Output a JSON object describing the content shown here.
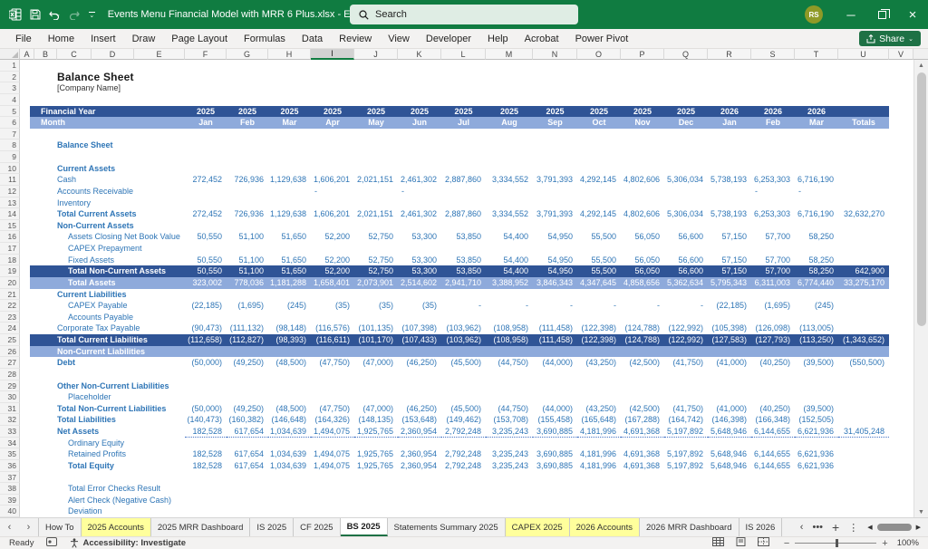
{
  "window": {
    "title": "Events Menu Financial Model with MRR 6 Plus.xlsx  -  Excel",
    "search_label": "Search",
    "avatar_initials": "RS"
  },
  "ribbon": {
    "tabs": [
      "File",
      "Home",
      "Insert",
      "Draw",
      "Page Layout",
      "Formulas",
      "Data",
      "Review",
      "View",
      "Developer",
      "Help",
      "Acrobat",
      "Power Pivot"
    ],
    "share_label": "Share"
  },
  "grid": {
    "columns": [
      "A",
      "B",
      "C",
      "D",
      "E",
      "F",
      "G",
      "H",
      "I",
      "J",
      "K",
      "L",
      "M",
      "N",
      "O",
      "P",
      "Q",
      "R",
      "S",
      "T",
      "U",
      "V"
    ],
    "selected_column": "I"
  },
  "sheet": {
    "header": {
      "financial_year_label": "Financial Year",
      "month_label": "Month",
      "totals_label": "Totals",
      "years": [
        "2025",
        "2025",
        "2025",
        "2025",
        "2025",
        "2025",
        "2025",
        "2025",
        "2025",
        "2025",
        "2025",
        "2025",
        "2026",
        "2026",
        "2026"
      ],
      "months": [
        "Jan",
        "Feb",
        "Mar",
        "Apr",
        "May",
        "Jun",
        "Jul",
        "Aug",
        "Sep",
        "Oct",
        "Nov",
        "Dec",
        "Jan",
        "Feb",
        "Mar"
      ]
    },
    "rows": [
      {
        "n": 1
      },
      {
        "n": 2,
        "label": "Balance Sheet",
        "style": "title"
      },
      {
        "n": 3,
        "label": "[Company Name]",
        "style": "subtitle"
      },
      {
        "n": 4
      },
      {
        "n": 5,
        "style": "year-header"
      },
      {
        "n": 6,
        "style": "month-header"
      },
      {
        "n": 7
      },
      {
        "n": 8,
        "label": "Balance Sheet",
        "style": "bold"
      },
      {
        "n": 9
      },
      {
        "n": 10,
        "label": "Current Assets",
        "style": "bold"
      },
      {
        "n": 11,
        "label": "Cash",
        "style": "plain",
        "values": [
          "272,452",
          "726,936",
          "1,129,638",
          "1,606,201",
          "2,021,151",
          "2,461,302",
          "2,887,860",
          "3,334,552",
          "3,791,393",
          "4,292,145",
          "4,802,606",
          "5,306,034",
          "5,738,193",
          "6,253,303",
          "6,716,190"
        ]
      },
      {
        "n": 12,
        "label": "Accounts Receivable",
        "style": "plain",
        "dash_left": true,
        "values": [
          "",
          "",
          "",
          "-",
          "",
          "-",
          "",
          "",
          "",
          "",
          "",
          "",
          "",
          "-",
          "-"
        ]
      },
      {
        "n": 13,
        "label": "Inventory",
        "style": "plain"
      },
      {
        "n": 14,
        "label": "Total Current Assets",
        "style": "bold",
        "values": [
          "272,452",
          "726,936",
          "1,129,638",
          "1,606,201",
          "2,021,151",
          "2,461,302",
          "2,887,860",
          "3,334,552",
          "3,791,393",
          "4,292,145",
          "4,802,606",
          "5,306,034",
          "5,738,193",
          "6,253,303",
          "6,716,190"
        ],
        "total": "32,632,270"
      },
      {
        "n": 15,
        "label": "Non-Current Assets",
        "style": "bold"
      },
      {
        "n": 16,
        "label": "Assets Closing Net Book Value",
        "style": "plain",
        "indent": 1,
        "values": [
          "50,550",
          "51,100",
          "51,650",
          "52,200",
          "52,750",
          "53,300",
          "53,850",
          "54,400",
          "54,950",
          "55,500",
          "56,050",
          "56,600",
          "57,150",
          "57,700",
          "58,250"
        ]
      },
      {
        "n": 17,
        "label": "CAPEX Prepayment",
        "style": "plain",
        "indent": 1
      },
      {
        "n": 18,
        "label": "Fixed Assets",
        "style": "plain",
        "indent": 1,
        "values": [
          "50,550",
          "51,100",
          "51,650",
          "52,200",
          "52,750",
          "53,300",
          "53,850",
          "54,400",
          "54,950",
          "55,500",
          "56,050",
          "56,600",
          "57,150",
          "57,700",
          "58,250"
        ]
      },
      {
        "n": 19,
        "label": "Total Non-Current Assets",
        "style": "band-dark",
        "indent": 1,
        "values": [
          "50,550",
          "51,100",
          "51,650",
          "52,200",
          "52,750",
          "53,300",
          "53,850",
          "54,400",
          "54,950",
          "55,500",
          "56,050",
          "56,600",
          "57,150",
          "57,700",
          "58,250"
        ],
        "total": "642,900"
      },
      {
        "n": 20,
        "label": "Total Assets",
        "style": "band-light",
        "indent": 1,
        "values": [
          "323,002",
          "778,036",
          "1,181,288",
          "1,658,401",
          "2,073,901",
          "2,514,602",
          "2,941,710",
          "3,388,952",
          "3,846,343",
          "4,347,645",
          "4,858,656",
          "5,362,634",
          "5,795,343",
          "6,311,003",
          "6,774,440"
        ],
        "total": "33,275,170"
      },
      {
        "n": 21,
        "label": "Current Liabilities",
        "style": "bold"
      },
      {
        "n": 22,
        "label": "CAPEX Payable",
        "style": "plain",
        "indent": 1,
        "values": [
          "(22,185)",
          "(1,695)",
          "(245)",
          "(35)",
          "(35)",
          "(35)",
          "-",
          "-",
          "-",
          "-",
          "-",
          "-",
          "(22,185)",
          "(1,695)",
          "(245)"
        ]
      },
      {
        "n": 23,
        "label": "Accounts Payable",
        "style": "plain",
        "indent": 1
      },
      {
        "n": 24,
        "label": "Corporate Tax Payable",
        "style": "plain",
        "values": [
          "(90,473)",
          "(111,132)",
          "(98,148)",
          "(116,576)",
          "(101,135)",
          "(107,398)",
          "(103,962)",
          "(108,958)",
          "(111,458)",
          "(122,398)",
          "(124,788)",
          "(122,992)",
          "(105,398)",
          "(126,098)",
          "(113,005)"
        ]
      },
      {
        "n": 25,
        "label": "Total Current Liabilities",
        "style": "band-dark",
        "values": [
          "(112,658)",
          "(112,827)",
          "(98,393)",
          "(116,611)",
          "(101,170)",
          "(107,433)",
          "(103,962)",
          "(108,958)",
          "(111,458)",
          "(122,398)",
          "(124,788)",
          "(122,992)",
          "(127,583)",
          "(127,793)",
          "(113,250)"
        ],
        "total": "(1,343,652)"
      },
      {
        "n": 26,
        "label": "Non-Current Liabilities",
        "style": "band-light"
      },
      {
        "n": 27,
        "label": "Debt",
        "style": "bold",
        "values": [
          "(50,000)",
          "(49,250)",
          "(48,500)",
          "(47,750)",
          "(47,000)",
          "(46,250)",
          "(45,500)",
          "(44,750)",
          "(44,000)",
          "(43,250)",
          "(42,500)",
          "(41,750)",
          "(41,000)",
          "(40,250)",
          "(39,500)"
        ],
        "total": "(550,500)"
      },
      {
        "n": 28
      },
      {
        "n": 29,
        "label": "Other Non-Current Liabilities",
        "style": "bold"
      },
      {
        "n": 30,
        "label": "Placeholder",
        "style": "plain",
        "indent": 1
      },
      {
        "n": 31,
        "label": "Total Non-Current Liabilities",
        "style": "bold",
        "values": [
          "(50,000)",
          "(49,250)",
          "(48,500)",
          "(47,750)",
          "(47,000)",
          "(46,250)",
          "(45,500)",
          "(44,750)",
          "(44,000)",
          "(43,250)",
          "(42,500)",
          "(41,750)",
          "(41,000)",
          "(40,250)",
          "(39,500)"
        ]
      },
      {
        "n": 32,
        "label": "Total Liabilities",
        "style": "bold",
        "values": [
          "(140,473)",
          "(160,382)",
          "(146,648)",
          "(164,326)",
          "(148,135)",
          "(153,648)",
          "(149,462)",
          "(153,708)",
          "(155,458)",
          "(165,648)",
          "(167,288)",
          "(164,742)",
          "(146,398)",
          "(166,348)",
          "(152,505)"
        ]
      },
      {
        "n": 33,
        "label": "Net Assets",
        "style": "bold",
        "dotted": true,
        "values": [
          "182,528",
          "617,654",
          "1,034,639",
          "1,494,075",
          "1,925,765",
          "2,360,954",
          "2,792,248",
          "3,235,243",
          "3,690,885",
          "4,181,996",
          "4,691,368",
          "5,197,892",
          "5,648,946",
          "6,144,655",
          "6,621,936"
        ],
        "total": "31,405,248"
      },
      {
        "n": 34,
        "label": "Ordinary Equity",
        "style": "plain",
        "indent": 1
      },
      {
        "n": 35,
        "label": "Retained Profits",
        "style": "plain",
        "indent": 1,
        "values": [
          "182,528",
          "617,654",
          "1,034,639",
          "1,494,075",
          "1,925,765",
          "2,360,954",
          "2,792,248",
          "3,235,243",
          "3,690,885",
          "4,181,996",
          "4,691,368",
          "5,197,892",
          "5,648,946",
          "6,144,655",
          "6,621,936"
        ]
      },
      {
        "n": 36,
        "label": "Total Equity",
        "style": "bold",
        "indent": 1,
        "values": [
          "182,528",
          "617,654",
          "1,034,639",
          "1,494,075",
          "1,925,765",
          "2,360,954",
          "2,792,248",
          "3,235,243",
          "3,690,885",
          "4,181,996",
          "4,691,368",
          "5,197,892",
          "5,648,946",
          "6,144,655",
          "6,621,936"
        ]
      },
      {
        "n": 37
      },
      {
        "n": 38,
        "label": "Total Error Checks Result",
        "style": "plain",
        "indent": 1
      },
      {
        "n": 39,
        "label": "Alert Check (Negative Cash)",
        "style": "plain",
        "indent": 1
      },
      {
        "n": 40,
        "label": "Deviation",
        "style": "plain",
        "indent": 1
      }
    ]
  },
  "sheet_tabs": {
    "items": [
      {
        "label": "How To",
        "style": "normal"
      },
      {
        "label": "2025 Accounts",
        "style": "yellow"
      },
      {
        "label": "2025 MRR Dashboard",
        "style": "normal"
      },
      {
        "label": "IS 2025",
        "style": "normal"
      },
      {
        "label": "CF 2025",
        "style": "normal"
      },
      {
        "label": "BS 2025",
        "style": "active"
      },
      {
        "label": "Statements Summary 2025",
        "style": "normal"
      },
      {
        "label": "CAPEX 2025",
        "style": "yellow"
      },
      {
        "label": "2026 Accounts",
        "style": "yellow"
      },
      {
        "label": "2026 MRR Dashboard",
        "style": "normal"
      },
      {
        "label": "IS 2026",
        "style": "normal"
      }
    ],
    "more_label": "•••",
    "add_label": "+"
  },
  "status": {
    "ready_label": "Ready",
    "accessibility_label": "Accessibility: Investigate",
    "zoom_level": "100%"
  }
}
